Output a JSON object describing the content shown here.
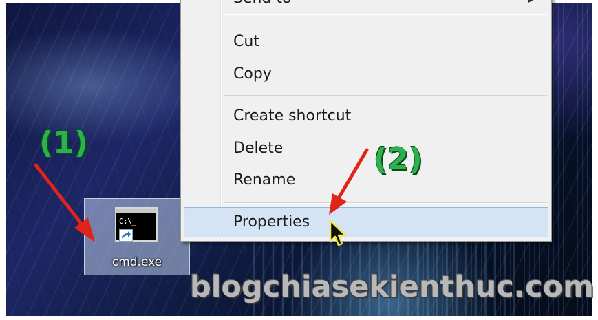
{
  "desktop": {
    "icon": {
      "label": "cmd.exe",
      "prompt_text": "C:\\_",
      "icon_name": "cmd-console-icon"
    }
  },
  "context_menu": {
    "items": [
      {
        "label": "Send to",
        "has_submenu": true,
        "visible": "partial"
      },
      {
        "label": "Cut"
      },
      {
        "label": "Copy"
      },
      {
        "label": "Create shortcut"
      },
      {
        "label": "Delete"
      },
      {
        "label": "Rename"
      },
      {
        "label": "Properties",
        "highlighted": true
      }
    ]
  },
  "annotations": {
    "step1": "(1)",
    "step2": "(2)",
    "arrow_color": "#e2231a",
    "label_color": "#2bb24c"
  },
  "watermark": "blogchiasekienthuc.com",
  "colors": {
    "menu_background": "#f0f0f0",
    "menu_highlight": "#d5e4f4",
    "menu_highlight_border": "#93b6de"
  }
}
